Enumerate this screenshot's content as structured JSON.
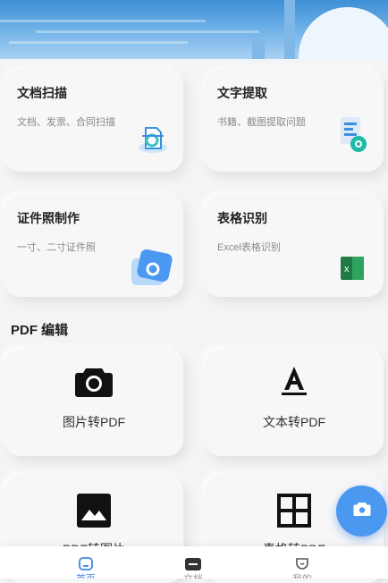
{
  "cards": [
    {
      "title": "文档扫描",
      "subtitle": "文档、发票、合同扫描",
      "icon": "scan-icon"
    },
    {
      "title": "文字提取",
      "subtitle": "书籍、截图提取问题",
      "icon": "text-extract-icon"
    },
    {
      "title": "证件照制作",
      "subtitle": "一寸、二寸证件照",
      "icon": "id-photo-icon"
    },
    {
      "title": "表格识别",
      "subtitle": "Excel表格识别",
      "icon": "excel-icon"
    }
  ],
  "pdf_section": {
    "title": "PDF 编辑",
    "tools": [
      {
        "label": "图片转PDF",
        "icon": "camera-icon"
      },
      {
        "label": "文本转PDF",
        "icon": "text-icon"
      },
      {
        "label": "PDF转图片",
        "icon": "image-icon"
      },
      {
        "label": "表格转PDF",
        "icon": "grid-icon"
      }
    ]
  },
  "fab": {
    "icon": "camera-icon"
  },
  "tabbar": {
    "tabs": [
      {
        "label": "首页",
        "icon": "home-icon",
        "active": true
      },
      {
        "label": "文档",
        "icon": "document-icon",
        "active": false
      },
      {
        "label": "我的",
        "icon": "profile-icon",
        "active": false
      }
    ]
  },
  "colors": {
    "accent": "#3d86e6",
    "fab": "#4a98f0",
    "excel": "#1f7a45"
  }
}
